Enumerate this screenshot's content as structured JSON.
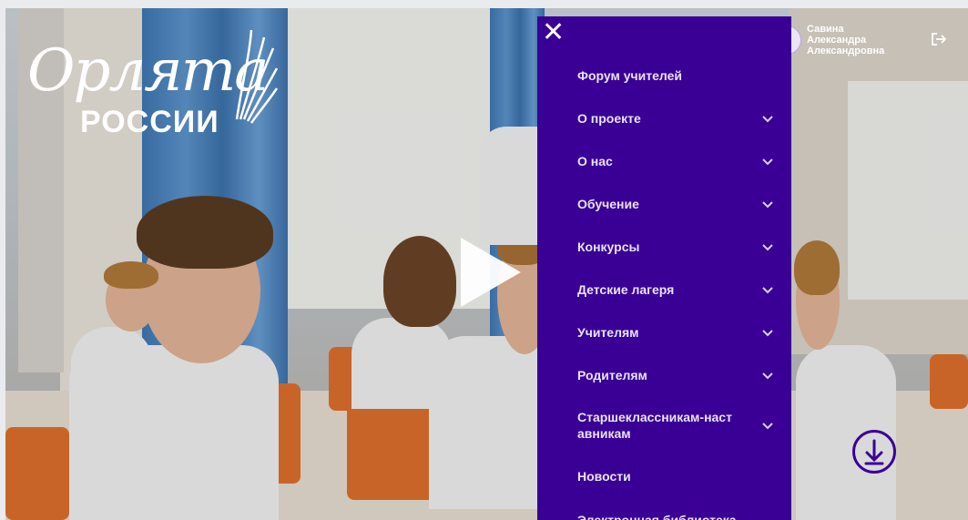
{
  "logo": {
    "script_text": "Орлята",
    "sub_text": "РОССИИ"
  },
  "video": {
    "play_icon": "play-icon"
  },
  "menu": {
    "close_icon": "close-icon",
    "background": "#3a0096",
    "items": [
      {
        "label": "Форум учителей",
        "has_submenu": false
      },
      {
        "label": "О проекте",
        "has_submenu": true
      },
      {
        "label": "О нас",
        "has_submenu": true
      },
      {
        "label": "Обучение",
        "has_submenu": true
      },
      {
        "label": "Конкурсы",
        "has_submenu": true
      },
      {
        "label": "Детские лагеря",
        "has_submenu": true
      },
      {
        "label": "Учителям",
        "has_submenu": true
      },
      {
        "label": "Родителям",
        "has_submenu": true
      },
      {
        "label": "Старшеклассникам-наставникам",
        "has_submenu": true
      },
      {
        "label": "Новости",
        "has_submenu": false
      },
      {
        "label": "Электронная библиотека",
        "has_submenu": false
      }
    ]
  },
  "user": {
    "name_line1": "Савина",
    "name_line2": "Александра",
    "name_line3": "Александровна",
    "logout_icon": "logout-icon"
  },
  "scroll_button": {
    "icon": "arrow-down-icon",
    "color": "#3a0096"
  }
}
